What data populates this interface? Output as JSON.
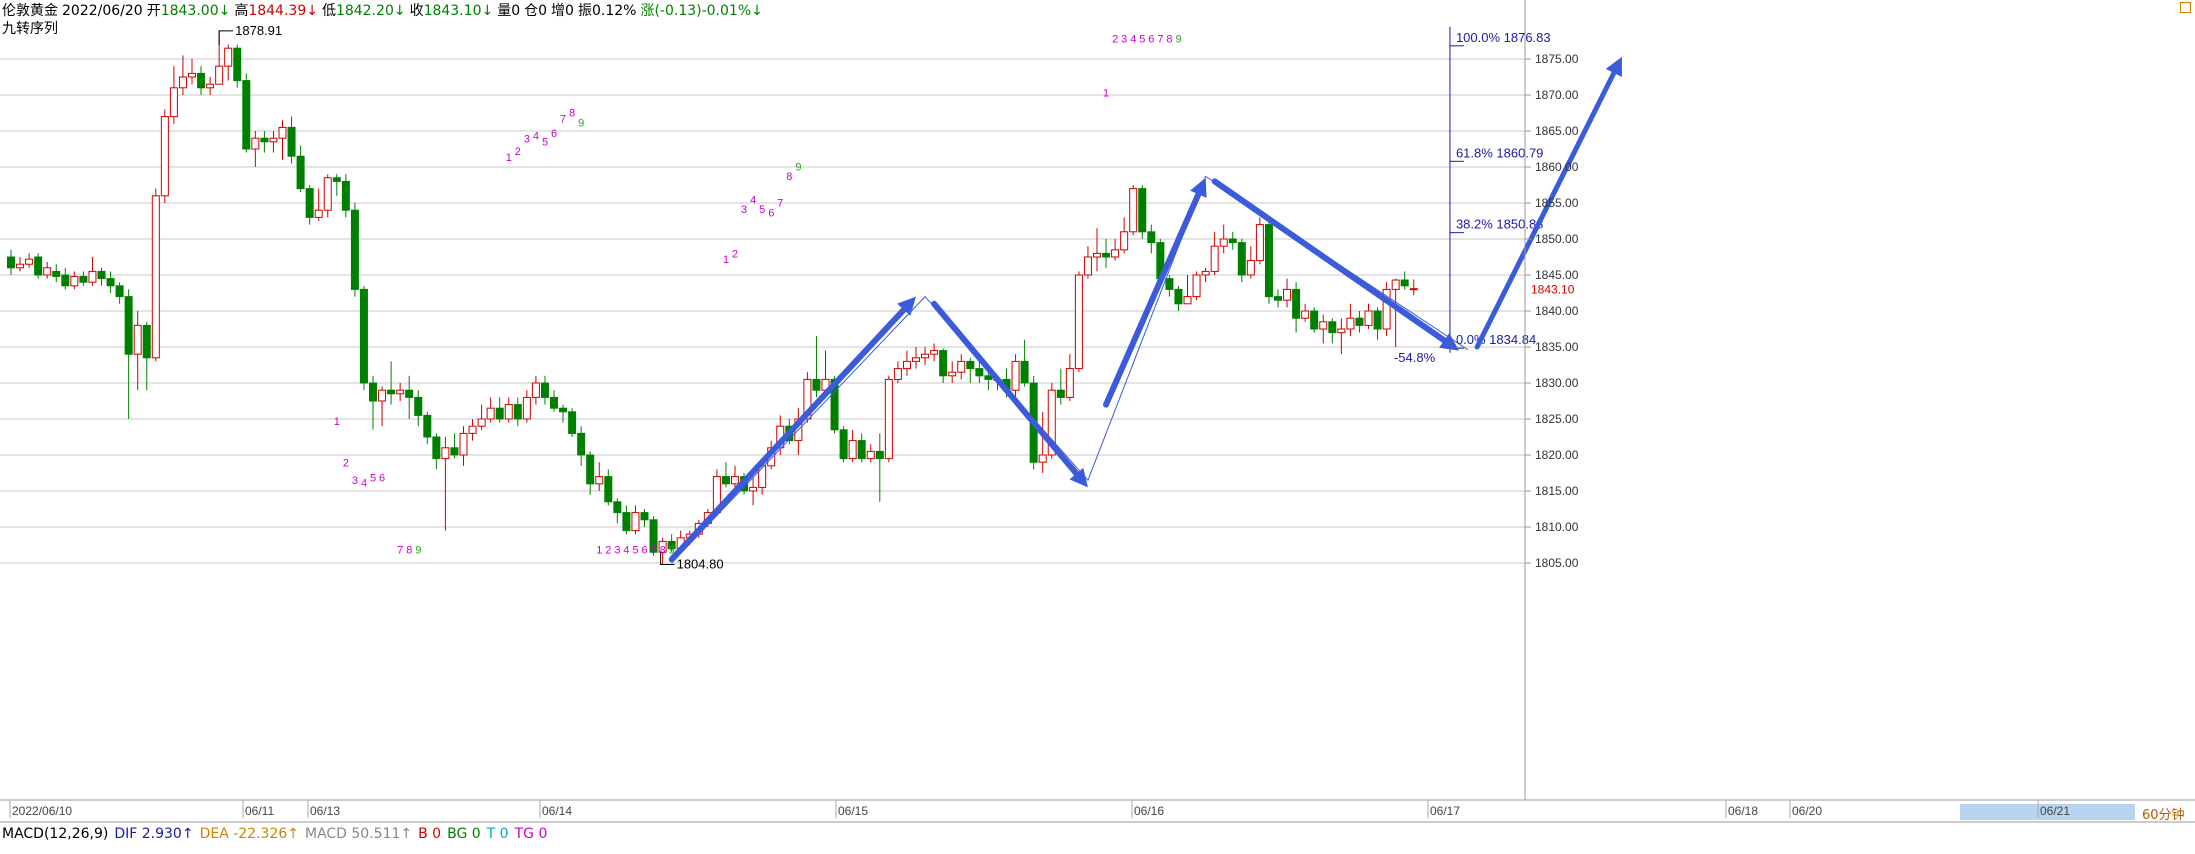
{
  "header": {
    "symbol": "伦敦黄金",
    "date": "2022/06/20",
    "open_label": "开",
    "open": "1843.00↓",
    "high_label": "高",
    "high": "1844.39↓",
    "low_label": "低",
    "low": "1842.20↓",
    "close_label": "收",
    "close": "1843.10↓",
    "volume": "量0",
    "position": "仓0",
    "increase": "增0",
    "amplitude": "振0.12%",
    "change": "涨(-0.13)-0.01%↓",
    "indicator_name": "九转序列"
  },
  "macd_bar": {
    "name": "MACD(12,26,9)",
    "dif": "DIF 2.930↑",
    "dea": "DEA -22.326↑",
    "macd": "MACD 50.511↑",
    "b": "B 0",
    "bg": "BG 0",
    "t": "T 0",
    "tg": "TG 0"
  },
  "period_label": "60分钟",
  "colors": {
    "up": "#d00000",
    "down": "#008000",
    "grid": "#c8c8c8",
    "arrow": "#3b5bdb",
    "fib": "#1a1aa8",
    "seq_magenta": "#cc00cc",
    "seq_green": "#22aa22"
  },
  "chart_data": {
    "type": "candlestick",
    "ylim": [
      1803,
      1881
    ],
    "y_ticks": [
      1805.0,
      1810.0,
      1815.0,
      1820.0,
      1825.0,
      1830.0,
      1835.0,
      1840.0,
      1845.0,
      1850.0,
      1855.0,
      1860.0,
      1865.0,
      1870.0,
      1875.0
    ],
    "x_labels": [
      "2022/06/10",
      "06/11",
      "06/13",
      "06/14",
      "06/15",
      "06/16",
      "06/17",
      "06/18",
      "06/20",
      "06/21"
    ],
    "last_price": "1843.10",
    "candles": [
      [
        1847.5,
        1846,
        1848.5,
        1845
      ],
      [
        1846,
        1846.5,
        1847.5,
        1845.5
      ],
      [
        1846.5,
        1847.2,
        1848,
        1846
      ],
      [
        1847.5,
        1845,
        1848,
        1844.5
      ],
      [
        1845,
        1846,
        1846.8,
        1844.5
      ],
      [
        1845.5,
        1844.8,
        1846.5,
        1844
      ],
      [
        1845,
        1843.5,
        1846,
        1843
      ],
      [
        1843.5,
        1844.8,
        1845.5,
        1843
      ],
      [
        1844.8,
        1844,
        1845.5,
        1843.5
      ],
      [
        1844,
        1845.5,
        1847.5,
        1843.5
      ],
      [
        1845.5,
        1844.5,
        1846,
        1843.5
      ],
      [
        1844.5,
        1843.5,
        1845.5,
        1842.5
      ],
      [
        1843.5,
        1842,
        1844,
        1841
      ],
      [
        1842,
        1834,
        1843,
        1825
      ],
      [
        1834,
        1838,
        1840,
        1829
      ],
      [
        1838,
        1833.5,
        1838.5,
        1829
      ],
      [
        1833.5,
        1856,
        1857,
        1833
      ],
      [
        1856,
        1867,
        1868,
        1855
      ],
      [
        1867,
        1871,
        1874,
        1866
      ],
      [
        1871,
        1872.5,
        1875.5,
        1870
      ],
      [
        1872.5,
        1873,
        1875,
        1871.5
      ],
      [
        1873,
        1871,
        1874,
        1870
      ],
      [
        1871,
        1871.5,
        1872.5,
        1870
      ],
      [
        1871.5,
        1874,
        1878.91,
        1872
      ],
      [
        1874,
        1876.5,
        1877,
        1872
      ],
      [
        1876.5,
        1872,
        1877,
        1871
      ],
      [
        1872,
        1862.5,
        1873,
        1862
      ],
      [
        1862.5,
        1864,
        1865,
        1860
      ],
      [
        1864,
        1863.5,
        1865,
        1862
      ],
      [
        1863.5,
        1864,
        1865,
        1862
      ],
      [
        1864,
        1865.5,
        1866.5,
        1861
      ],
      [
        1865.5,
        1861.5,
        1867,
        1860.5
      ],
      [
        1861.5,
        1857,
        1863,
        1856.5
      ],
      [
        1857,
        1853,
        1857.5,
        1852
      ],
      [
        1853,
        1854,
        1857,
        1852.5
      ],
      [
        1854,
        1858.5,
        1859,
        1853
      ],
      [
        1858.5,
        1858,
        1859,
        1856
      ],
      [
        1858,
        1854,
        1859,
        1853
      ],
      [
        1854,
        1843,
        1855,
        1842
      ],
      [
        1843,
        1830,
        1843.5,
        1829
      ],
      [
        1830,
        1827.5,
        1831,
        1823.5
      ],
      [
        1827.5,
        1829,
        1829.5,
        1824
      ],
      [
        1829,
        1828.5,
        1833,
        1827
      ],
      [
        1828.5,
        1829,
        1830,
        1827.5
      ],
      [
        1829,
        1828,
        1831,
        1825
      ],
      [
        1828,
        1825.5,
        1829,
        1824
      ],
      [
        1825.5,
        1822.5,
        1826,
        1821.5
      ],
      [
        1822.5,
        1819.5,
        1823,
        1818
      ],
      [
        1819.5,
        1821,
        1822.5,
        1809.5
      ],
      [
        1821,
        1820,
        1823,
        1819.5
      ],
      [
        1820,
        1823,
        1824,
        1818.5
      ],
      [
        1823,
        1824,
        1825,
        1822
      ],
      [
        1824,
        1825,
        1827,
        1823.5
      ],
      [
        1825,
        1826.5,
        1828,
        1824.5
      ],
      [
        1826.5,
        1825,
        1828,
        1824.5
      ],
      [
        1825,
        1827,
        1828,
        1824.5
      ],
      [
        1827,
        1825,
        1828,
        1824
      ],
      [
        1825,
        1828,
        1829,
        1824.5
      ],
      [
        1828,
        1830,
        1831,
        1827
      ],
      [
        1830,
        1828,
        1831,
        1827
      ],
      [
        1828,
        1826.5,
        1829,
        1826
      ],
      [
        1826.5,
        1826,
        1827,
        1824.5
      ],
      [
        1826,
        1823,
        1826.5,
        1822.5
      ],
      [
        1823,
        1820,
        1824,
        1818.5
      ],
      [
        1820,
        1816,
        1820.5,
        1814.5
      ],
      [
        1816,
        1817,
        1819,
        1815
      ],
      [
        1817,
        1813.5,
        1818,
        1813
      ],
      [
        1813.5,
        1812,
        1814,
        1810.5
      ],
      [
        1812,
        1809.5,
        1813,
        1809
      ],
      [
        1809.5,
        1812,
        1813,
        1809
      ],
      [
        1812,
        1811,
        1812.5,
        1810
      ],
      [
        1811,
        1806.5,
        1811.5,
        1806
      ],
      [
        1806.5,
        1808,
        1808.5,
        1804.8
      ],
      [
        1808,
        1807,
        1809,
        1806.5
      ],
      [
        1807,
        1808.5,
        1809.5,
        1806.5
      ],
      [
        1808.5,
        1809,
        1809.5,
        1807.5
      ],
      [
        1809,
        1810.5,
        1811,
        1808.5
      ],
      [
        1810.5,
        1812,
        1812.5,
        1810
      ],
      [
        1812,
        1817,
        1818,
        1811.5
      ],
      [
        1817,
        1816,
        1819,
        1815.5
      ],
      [
        1816,
        1817,
        1818.5,
        1815
      ],
      [
        1817,
        1815,
        1817.5,
        1814.5
      ],
      [
        1815,
        1815.5,
        1817,
        1813
      ],
      [
        1815.5,
        1818.5,
        1819.5,
        1814.5
      ],
      [
        1818.5,
        1821,
        1822,
        1818
      ],
      [
        1821,
        1824,
        1825.5,
        1820
      ],
      [
        1824,
        1822,
        1825,
        1821.5
      ],
      [
        1822,
        1825,
        1826.5,
        1820
      ],
      [
        1825,
        1830.5,
        1831.5,
        1824.5
      ],
      [
        1830.5,
        1829,
        1836.5,
        1828
      ],
      [
        1829,
        1830.5,
        1834.5,
        1829
      ],
      [
        1830.5,
        1823.5,
        1831,
        1823
      ],
      [
        1823.5,
        1819.5,
        1824,
        1819
      ],
      [
        1819.5,
        1822,
        1823.5,
        1819
      ],
      [
        1822,
        1819.5,
        1823,
        1819
      ],
      [
        1819.5,
        1820.5,
        1821.5,
        1819
      ],
      [
        1820.5,
        1819.5,
        1823,
        1813.5
      ],
      [
        1819.5,
        1830.5,
        1831,
        1819
      ],
      [
        1830.5,
        1832,
        1833,
        1830
      ],
      [
        1832,
        1833,
        1834.5,
        1831
      ],
      [
        1833,
        1833.5,
        1835,
        1832
      ],
      [
        1833.5,
        1834,
        1835,
        1832.5
      ],
      [
        1834,
        1834.5,
        1835.5,
        1833
      ],
      [
        1834.5,
        1831,
        1834.8,
        1830
      ],
      [
        1831,
        1831.5,
        1833,
        1830
      ],
      [
        1831.5,
        1833,
        1834,
        1830.5
      ],
      [
        1833,
        1832,
        1833.5,
        1830
      ],
      [
        1832,
        1831,
        1833,
        1830
      ],
      [
        1831,
        1830.5,
        1832,
        1829
      ],
      [
        1830.5,
        1830.5,
        1831,
        1829
      ],
      [
        1830.5,
        1829,
        1832,
        1828
      ],
      [
        1829,
        1833,
        1834,
        1828
      ],
      [
        1833,
        1830,
        1836,
        1829.5
      ],
      [
        1830,
        1819,
        1831,
        1818
      ],
      [
        1819,
        1820,
        1826,
        1817.5
      ],
      [
        1820,
        1829,
        1830,
        1819.5
      ],
      [
        1829,
        1828,
        1832,
        1827
      ],
      [
        1828,
        1832,
        1834,
        1827.5
      ],
      [
        1832,
        1845,
        1845.5,
        1831.5
      ],
      [
        1845,
        1847.5,
        1849,
        1844.5
      ],
      [
        1847.5,
        1848,
        1851.5,
        1845.5
      ],
      [
        1848,
        1847.5,
        1850,
        1846
      ],
      [
        1847.5,
        1848.5,
        1850,
        1847
      ],
      [
        1848.5,
        1851,
        1853,
        1848
      ],
      [
        1851,
        1857,
        1857.5,
        1850.5
      ],
      [
        1857,
        1851,
        1857.5,
        1850
      ],
      [
        1851,
        1849.5,
        1852,
        1848
      ],
      [
        1849.5,
        1844.5,
        1850,
        1844
      ],
      [
        1844.5,
        1843,
        1845,
        1842
      ],
      [
        1843,
        1841,
        1843.5,
        1840
      ],
      [
        1841,
        1842,
        1845,
        1841
      ],
      [
        1842,
        1845,
        1845.5,
        1841.5
      ],
      [
        1845,
        1845.5,
        1846,
        1844
      ],
      [
        1845.5,
        1849,
        1851,
        1845
      ],
      [
        1849,
        1850,
        1852,
        1848
      ],
      [
        1850,
        1849.5,
        1851,
        1848.5
      ],
      [
        1849.5,
        1845,
        1850,
        1844
      ],
      [
        1845,
        1847,
        1849,
        1844.5
      ],
      [
        1847,
        1852,
        1853,
        1846.5
      ],
      [
        1852,
        1842,
        1852.5,
        1841
      ],
      [
        1842,
        1841.5,
        1843,
        1840.5
      ],
      [
        1841.5,
        1843,
        1844.5,
        1840.5
      ],
      [
        1843,
        1839,
        1844,
        1837
      ],
      [
        1839,
        1840,
        1841,
        1838.5
      ],
      [
        1840,
        1837.5,
        1840.5,
        1837
      ],
      [
        1837.5,
        1838.5,
        1839.5,
        1835.5
      ],
      [
        1838.5,
        1837,
        1839,
        1835.5
      ],
      [
        1837,
        1837.5,
        1839,
        1834
      ],
      [
        1837.5,
        1839,
        1841,
        1836.5
      ],
      [
        1839,
        1838,
        1840,
        1837
      ],
      [
        1838,
        1840,
        1841,
        1837.5
      ],
      [
        1840,
        1837.5,
        1840.5,
        1836
      ],
      [
        1837.5,
        1843,
        1844,
        1836.5
      ],
      [
        1843,
        1844.3,
        1844.5,
        1835
      ],
      [
        1844.3,
        1843.5,
        1845.5,
        1843
      ],
      [
        1843,
        1843.1,
        1844.39,
        1842.2
      ]
    ],
    "annotations": [
      {
        "text": "1878.91",
        "x": 23,
        "y": 1878.91
      },
      {
        "text": "1804.80",
        "x": 72,
        "y": 1804.8
      },
      {
        "text": "1843.10",
        "x": 159,
        "y": 1843.1
      }
    ],
    "fibonacci": [
      {
        "label": "100.0% 1876.83",
        "value": 1876.83
      },
      {
        "label": "61.8% 1860.79",
        "value": 1860.79
      },
      {
        "label": "38.2% 1850.88",
        "value": 1850.88
      },
      {
        "label": "0.0% 1834.84",
        "value": 1834.84
      },
      {
        "label": "-54.8%",
        "value": 1834.84
      }
    ],
    "sequence_labels": [
      {
        "text": "1",
        "x": 36,
        "y": 1824.2,
        "color": "magenta"
      },
      {
        "text": "2",
        "x": 37,
        "y": 1818.4,
        "color": "magenta"
      },
      {
        "text": "3",
        "x": 38,
        "y": 1816.0,
        "color": "magenta"
      },
      {
        "text": "4",
        "x": 39,
        "y": 1815.6,
        "color": "magenta"
      },
      {
        "text": "5",
        "x": 40,
        "y": 1816.3,
        "color": "magenta"
      },
      {
        "text": "6",
        "x": 41,
        "y": 1816.3,
        "color": "magenta"
      },
      {
        "text": "7",
        "x": 43,
        "y": 1806.3,
        "color": "magenta"
      },
      {
        "text": "8",
        "x": 44,
        "y": 1806.3,
        "color": "magenta"
      },
      {
        "text": "9",
        "x": 45,
        "y": 1806.3,
        "color": "green"
      },
      {
        "text": "1",
        "x": 55,
        "y": 1860.8,
        "color": "magenta"
      },
      {
        "text": "2",
        "x": 56,
        "y": 1861.7,
        "color": "magenta"
      },
      {
        "text": "3",
        "x": 57,
        "y": 1863.4,
        "color": "magenta"
      },
      {
        "text": "4",
        "x": 58,
        "y": 1863.8,
        "color": "magenta"
      },
      {
        "text": "5",
        "x": 59,
        "y": 1863.0,
        "color": "magenta"
      },
      {
        "text": "6",
        "x": 60,
        "y": 1864.2,
        "color": "magenta"
      },
      {
        "text": "7",
        "x": 61,
        "y": 1866.2,
        "color": "magenta"
      },
      {
        "text": "8",
        "x": 62,
        "y": 1867.0,
        "color": "magenta"
      },
      {
        "text": "9",
        "x": 63,
        "y": 1865.6,
        "color": "green"
      },
      {
        "text": "1",
        "x": 65,
        "y": 1806.3,
        "color": "magenta"
      },
      {
        "text": "2",
        "x": 66,
        "y": 1806.3,
        "color": "magenta"
      },
      {
        "text": "3",
        "x": 67,
        "y": 1806.3,
        "color": "magenta"
      },
      {
        "text": "4",
        "x": 68,
        "y": 1806.3,
        "color": "magenta"
      },
      {
        "text": "5",
        "x": 69,
        "y": 1806.3,
        "color": "magenta"
      },
      {
        "text": "6",
        "x": 70,
        "y": 1806.3,
        "color": "magenta"
      },
      {
        "text": "7",
        "x": 71,
        "y": 1806.3,
        "color": "magenta"
      },
      {
        "text": "8",
        "x": 72,
        "y": 1806.3,
        "color": "magenta"
      },
      {
        "text": "9",
        "x": 73,
        "y": 1806.3,
        "color": "green"
      },
      {
        "text": "1",
        "x": 79,
        "y": 1846.7,
        "color": "magenta"
      },
      {
        "text": "2",
        "x": 80,
        "y": 1847.4,
        "color": "magenta"
      },
      {
        "text": "3",
        "x": 81,
        "y": 1853.6,
        "color": "magenta"
      },
      {
        "text": "4",
        "x": 82,
        "y": 1854.9,
        "color": "magenta"
      },
      {
        "text": "5",
        "x": 83,
        "y": 1853.6,
        "color": "magenta"
      },
      {
        "text": "6",
        "x": 84,
        "y": 1853.1,
        "color": "magenta"
      },
      {
        "text": "7",
        "x": 85,
        "y": 1854.5,
        "color": "magenta"
      },
      {
        "text": "8",
        "x": 86,
        "y": 1858.2,
        "color": "magenta"
      },
      {
        "text": "9",
        "x": 87,
        "y": 1859.5,
        "color": "green"
      },
      {
        "text": "1",
        "x": 121,
        "y": 1869.8,
        "color": "magenta"
      },
      {
        "text": "2",
        "x": 122,
        "y": 1877.3,
        "color": "magenta"
      },
      {
        "text": "3",
        "x": 123,
        "y": 1877.3,
        "color": "magenta"
      },
      {
        "text": "4",
        "x": 124,
        "y": 1877.3,
        "color": "magenta"
      },
      {
        "text": "5",
        "x": 125,
        "y": 1877.3,
        "color": "magenta"
      },
      {
        "text": "6",
        "x": 126,
        "y": 1877.3,
        "color": "magenta"
      },
      {
        "text": "7",
        "x": 127,
        "y": 1877.3,
        "color": "magenta"
      },
      {
        "text": "8",
        "x": 128,
        "y": 1877.3,
        "color": "magenta"
      },
      {
        "text": "9",
        "x": 129,
        "y": 1877.3,
        "color": "green"
      }
    ],
    "trend_arrows": [
      {
        "from": [
          73,
          1805.5
        ],
        "to": [
          100,
          1842
        ]
      },
      {
        "from": [
          102,
          1841
        ],
        "to": [
          119,
          1815.5
        ]
      },
      {
        "from": [
          121,
          1827
        ],
        "to": [
          132,
          1858.5
        ]
      },
      {
        "from": [
          133,
          1858
        ],
        "to": [
          160,
          1834.5
        ]
      },
      {
        "from": [
          162,
          1835
        ],
        "to": [
          178,
          1875.3
        ]
      }
    ],
    "thin_lines": [
      [
        [
          73,
          1805
        ],
        [
          101,
          1842
        ],
        [
          119,
          1816.5
        ],
        [
          132,
          1858.7
        ],
        [
          161,
          1834.6
        ]
      ]
    ]
  }
}
